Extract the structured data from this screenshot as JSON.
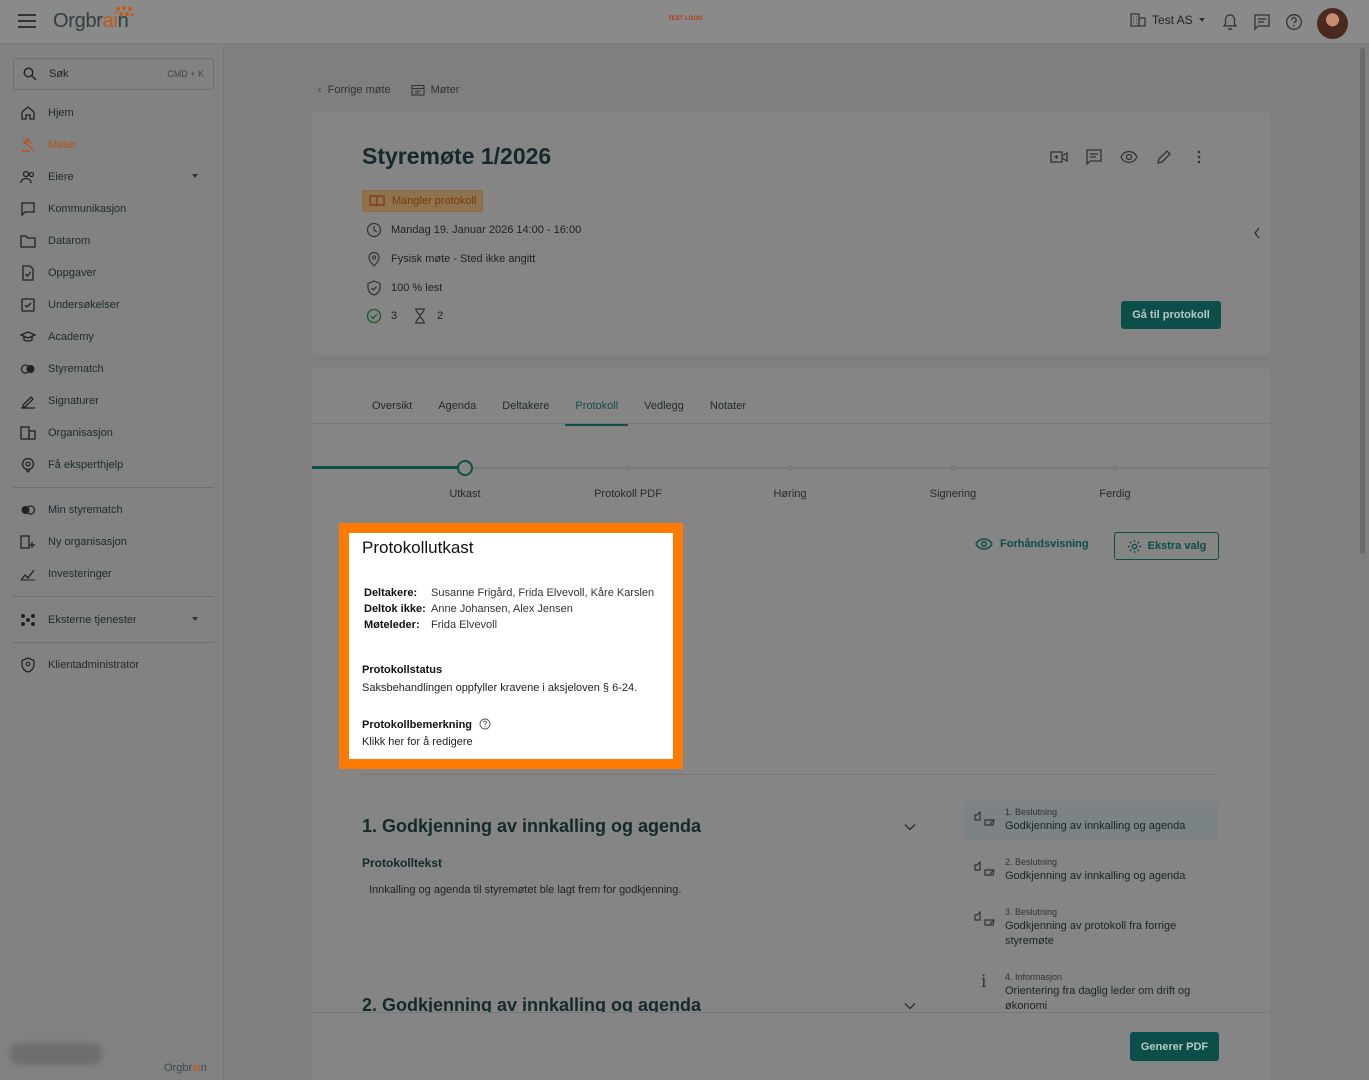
{
  "header": {
    "logo_text": "Orgbr",
    "logo_text_accent": "ai",
    "logo_text_end": "n",
    "test_logo": "TEST LOGO",
    "org_name": "Test AS"
  },
  "sidebar": {
    "search_label": "Søk",
    "search_shortcut": "CMD + K",
    "items": [
      {
        "label": "Hjem"
      },
      {
        "label": "Møter"
      },
      {
        "label": "Eiere"
      },
      {
        "label": "Kommunikasjon"
      },
      {
        "label": "Datarom"
      },
      {
        "label": "Oppgaver"
      },
      {
        "label": "Undersøkelser"
      },
      {
        "label": "Academy"
      },
      {
        "label": "Styrematch"
      },
      {
        "label": "Signaturer"
      },
      {
        "label": "Organisasjon"
      },
      {
        "label": "Få eksperthjelp"
      }
    ],
    "secondary": [
      {
        "label": "Min styrematch"
      },
      {
        "label": "Ny organisasjon"
      },
      {
        "label": "Investeringer"
      }
    ],
    "external": {
      "label": "Eksterne tjenester"
    },
    "client_admin": {
      "label": "Klientadministrator"
    },
    "footer_logo": "Orgbr",
    "footer_logo_accent": "ai",
    "footer_logo_end": "n"
  },
  "breadcrumb": {
    "back": "Forrige møte",
    "meetings": "Møter"
  },
  "meeting": {
    "title": "Styremøte 1/2026",
    "status_badge": "Mangler protokoll",
    "datetime": "Mandag 19. Januar 2026 14:00 - 16:00",
    "location": "Fysisk møte - Sted ikke angitt",
    "read": "100 % lest",
    "approved_count": "3",
    "pending_count": "2",
    "goto_protocol": "Gå til protokoll"
  },
  "tabs": [
    {
      "label": "Oversikt"
    },
    {
      "label": "Agenda"
    },
    {
      "label": "Deltakere"
    },
    {
      "label": "Protokoll"
    },
    {
      "label": "Vedlegg"
    },
    {
      "label": "Notater"
    }
  ],
  "steps": [
    {
      "label": "Utkast"
    },
    {
      "label": "Protokoll PDF"
    },
    {
      "label": "Høring"
    },
    {
      "label": "Signering"
    },
    {
      "label": "Ferdig"
    }
  ],
  "draft": {
    "title": "Protokollutkast",
    "participants_label": "Deltakere:",
    "participants": "Susanne Frigård, Frida Elvevoll, Kåre Karslen",
    "absent_label": "Deltok ikke:",
    "absent": "Anne Johansen, Alex Jensen",
    "leader_label": "Møteleder:",
    "leader": "Frida Elvevoll",
    "status_label": "Protokollstatus",
    "status_text": "Saksbehandlingen oppfyller kravene i aksjeloven § 6-24.",
    "remark_label": "Protokollbemerkning",
    "remark_text": "Klikk her for å redigere"
  },
  "actions": {
    "preview": "Forhåndsvisning",
    "extra": "Ekstra valg",
    "generate_pdf": "Generer PDF"
  },
  "sections": [
    {
      "title": "1. Godkjenning av innkalling og agenda",
      "protocol_label": "Protokolltekst",
      "protocol_text": "Innkalling og agenda til styremøtet ble lagt frem for godkjenning."
    },
    {
      "title": "2. Godkjenning av innkalling og agenda"
    }
  ],
  "agenda_items": [
    {
      "kind": "1. Beslutning",
      "title": "Godkjenning av innkalling og agenda"
    },
    {
      "kind": "2. Beslutning",
      "title": "Godkjenning av innkalling og agenda"
    },
    {
      "kind": "3. Beslutning",
      "title": "Godkjenning av protokoll fra forrige styremøte"
    },
    {
      "kind": "4. Informasjon",
      "title": "Orientering fra daglig leder om drift og økonomi"
    }
  ],
  "colors": {
    "brand_teal": "#0f4f49",
    "highlight": "#ff7a00",
    "accent_orange": "#c05a18"
  }
}
